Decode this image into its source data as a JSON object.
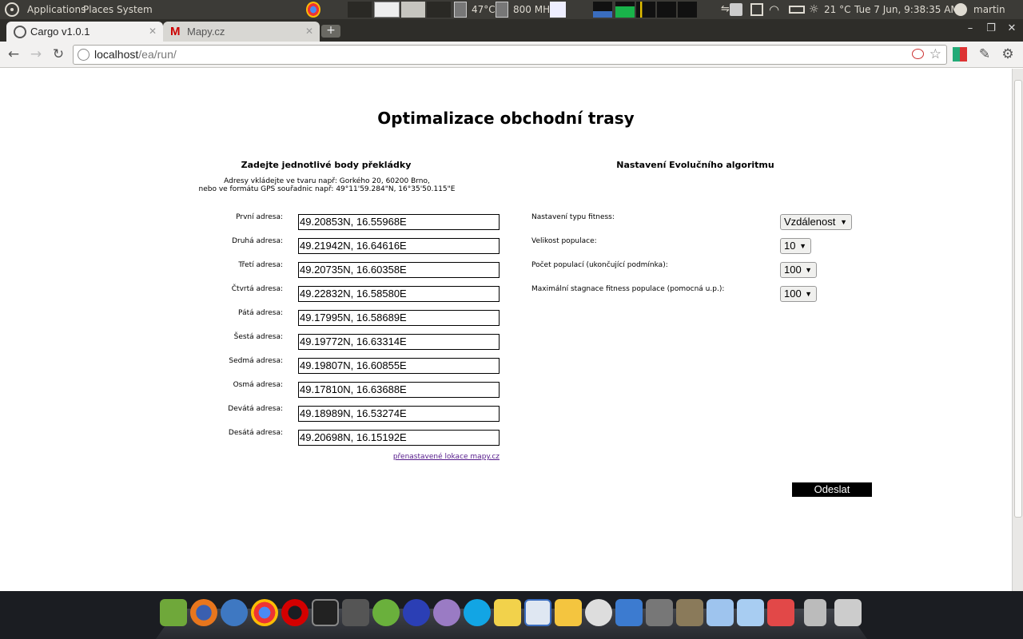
{
  "panel": {
    "menus": [
      "Applications",
      "Places",
      "System"
    ],
    "cpu_temp": "47°C",
    "cpu_freq": "800 MHz",
    "weather_temp": "21 °C",
    "datetime": "Tue  7 Jun,  9:38:35 AM",
    "user": "martin"
  },
  "browser": {
    "tabs": [
      {
        "title": "Cargo v1.0.1"
      },
      {
        "title": "Mapy.cz"
      }
    ],
    "new_tab_label": "+",
    "url_host": "localhost",
    "url_path": "/ea/run/"
  },
  "page": {
    "title": "Optimalizace obchodní trasy",
    "left_title": "Zadejte jednotlivé body překládky",
    "hint_line1": "Adresy vkládejte ve tvaru např: Gorkého 20, 60200 Brno,",
    "hint_line2": "nebo ve formátu GPS souřadnic např: 49°11'59.284\"N, 16°35'50.115\"E",
    "addresses": [
      {
        "label": "První adresa:",
        "value": "49.20853N, 16.55968E"
      },
      {
        "label": "Druhá adresa:",
        "value": "49.21942N, 16.64616E"
      },
      {
        "label": "Třetí adresa:",
        "value": "49.20735N, 16.60358E"
      },
      {
        "label": "Čtvrtá adresa:",
        "value": "49.22832N, 16.58580E"
      },
      {
        "label": "Pátá adresa:",
        "value": "49.17995N, 16.58689E"
      },
      {
        "label": "Šestá adresa:",
        "value": "49.19772N, 16.63314E"
      },
      {
        "label": "Sedmá adresa:",
        "value": "49.19807N, 16.60855E"
      },
      {
        "label": "Osmá adresa:",
        "value": "49.17810N, 16.63688E"
      },
      {
        "label": "Devátá adresa:",
        "value": "49.18989N, 16.53274E"
      },
      {
        "label": "Desátá adresa:",
        "value": "49.20698N, 16.15192E"
      }
    ],
    "link_text": "přenastavené lokace mapy.cz",
    "right_title": "Nastavení Evolučního algoritmu",
    "settings": [
      {
        "label": "Nastavení typu fitness:",
        "value": "Vzdálenost"
      },
      {
        "label": "Velikost populace:",
        "value": "10"
      },
      {
        "label": "Počet populací (ukončující podmínka):",
        "value": "100"
      },
      {
        "label": "Maximální stagnace fitness populace (pomocná u.p.):",
        "value": "100"
      }
    ],
    "submit_label": "Odeslat"
  },
  "icons": [
    "ubuntu-logo-icon",
    "chrome-icon",
    "cpu-icon",
    "network-icon",
    "volume-icon",
    "wifi-icon",
    "battery-icon",
    "weather-icon",
    "power-icon",
    "back-icon",
    "forward-icon",
    "reload-icon",
    "globe-icon",
    "star-icon",
    "wrench-icon"
  ]
}
